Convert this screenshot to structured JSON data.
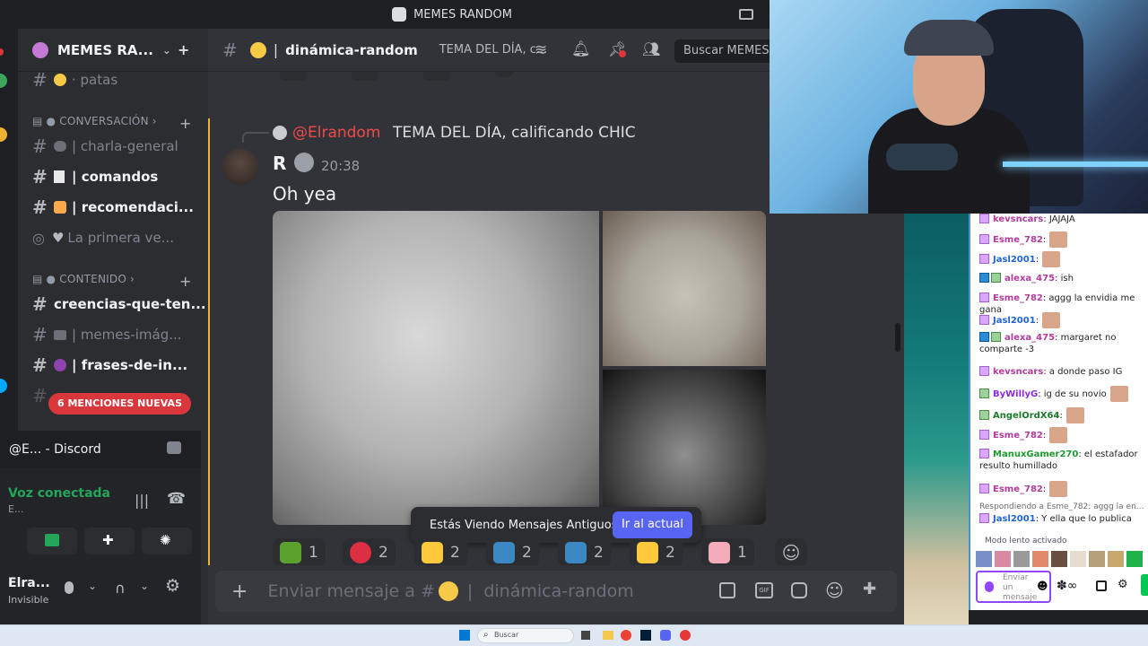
{
  "window": {
    "title": "MEMES RANDOM"
  },
  "sidebar": {
    "server_name": "MEMES RA...",
    "channels": [
      {
        "label": "· patas"
      },
      {
        "label": "| charla-general"
      },
      {
        "label": "| comandos"
      },
      {
        "label": "| recomendaci..."
      },
      {
        "label": "La primera ve..."
      },
      {
        "label": "creencias-que-ten..."
      },
      {
        "label": "| memes-imág..."
      },
      {
        "label": "| frases-de-in..."
      }
    ],
    "categories": [
      {
        "label": "CONVERSACIÓN"
      },
      {
        "label": "CONTENIDO"
      }
    ],
    "mentions_banner": "6 MENCIONES NUEVAS",
    "voice": {
      "window_label": "@E... - Discord",
      "status": "Voz conectada",
      "sub": "E..."
    },
    "user": {
      "name": "Elra...",
      "status": "Invisible"
    }
  },
  "header": {
    "channel": "dinámica-random",
    "topic": "TEMA DEL DÍA, c...",
    "search_placeholder": "Buscar MEMES"
  },
  "message": {
    "reply_mention": "@Elrandom",
    "reply_text": "TEMA DEL DÍA, calificando CHIC",
    "author": "R",
    "time": "20:38",
    "text": "Oh yea"
  },
  "reactions": [
    {
      "emoji": "check-emoji",
      "count": "1",
      "color": "#5aa02c"
    },
    {
      "emoji": "heart-emoji",
      "count": "2",
      "color": "#dd2e44"
    },
    {
      "emoji": "hand-emoji",
      "count": "2",
      "color": "#ffc83d"
    },
    {
      "emoji": "letter-i-emoji",
      "count": "2",
      "color": "#3b88c3"
    },
    {
      "emoji": "letter-g-emoji",
      "count": "2",
      "color": "#3b88c3"
    },
    {
      "emoji": "pointing-emoji",
      "count": "2",
      "color": "#ffc83d"
    },
    {
      "emoji": "scream-emoji",
      "count": "1",
      "color": "#f4abba"
    }
  ],
  "old_messages_bar": {
    "text": "Estás Viendo Mensajes Antiguos",
    "button": "Ir al actual"
  },
  "composer": {
    "placeholder": "Enviar mensaje a #",
    "channel": "dinámica-random"
  },
  "twitch_chat": {
    "messages": [
      {
        "user": "kevsncars",
        "text": ": JAJAJA",
        "color": "#b33b9e",
        "badge": "sub"
      },
      {
        "user": "Esme_782",
        "text": ":",
        "color": "#b33b9e",
        "badge": "sub",
        "emote": true
      },
      {
        "user": "Jasl2001",
        "text": ":",
        "color": "#1e64d6",
        "badge": "sub",
        "emote": true
      },
      {
        "user": "alexa_475",
        "text": ": ish",
        "color": "#b33b9e",
        "badge": "mod"
      },
      {
        "user": "Esme_782",
        "text": ": aggg la envidia me gana",
        "color": "#b33b9e",
        "badge": "sub"
      },
      {
        "user": "Jasl2001",
        "text": ":",
        "color": "#1e64d6",
        "badge": "sub",
        "emote": true
      },
      {
        "user": "alexa_475",
        "text": ": margaret no comparte -3",
        "color": "#b33b9e",
        "badge": "mod"
      },
      {
        "user": "kevsncars",
        "text": ": a donde paso IG",
        "color": "#b33b9e",
        "badge": "sub"
      },
      {
        "user": "ByWillyG",
        "text": ": ig de su novio",
        "color": "#8a2be2",
        "badge": "none",
        "emote": true
      },
      {
        "user": "AngelOrdX64",
        "text": ":",
        "color": "#1c7a2c",
        "badge": "none",
        "emote": true
      },
      {
        "user": "Esme_782",
        "text": ":",
        "color": "#b33b9e",
        "badge": "sub",
        "emote": true
      },
      {
        "user": "ManuxGamer270",
        "text": ": el estafador resulto humillado",
        "color": "#1c9a2c",
        "badge": "sub"
      },
      {
        "user": "Esme_782",
        "text": ":",
        "color": "#b33b9e",
        "badge": "sub",
        "emote": true
      },
      {
        "user": "Jasl2001",
        "text": ": Y ella que lo publica",
        "color": "#1e64d6",
        "badge": "sub"
      }
    ],
    "reply_hint": "Respondiendo a Esme_782: aggg la en...",
    "slow_mode": "Modo lento activado",
    "input_placeholder": "Enviar un mensaje",
    "input_emoji_label": "☻"
  },
  "taskbar": {
    "search": "Buscar"
  },
  "colors": {
    "accent": "#5865f2",
    "mention": "#da373c",
    "reply_mention": "#f04a4a"
  }
}
